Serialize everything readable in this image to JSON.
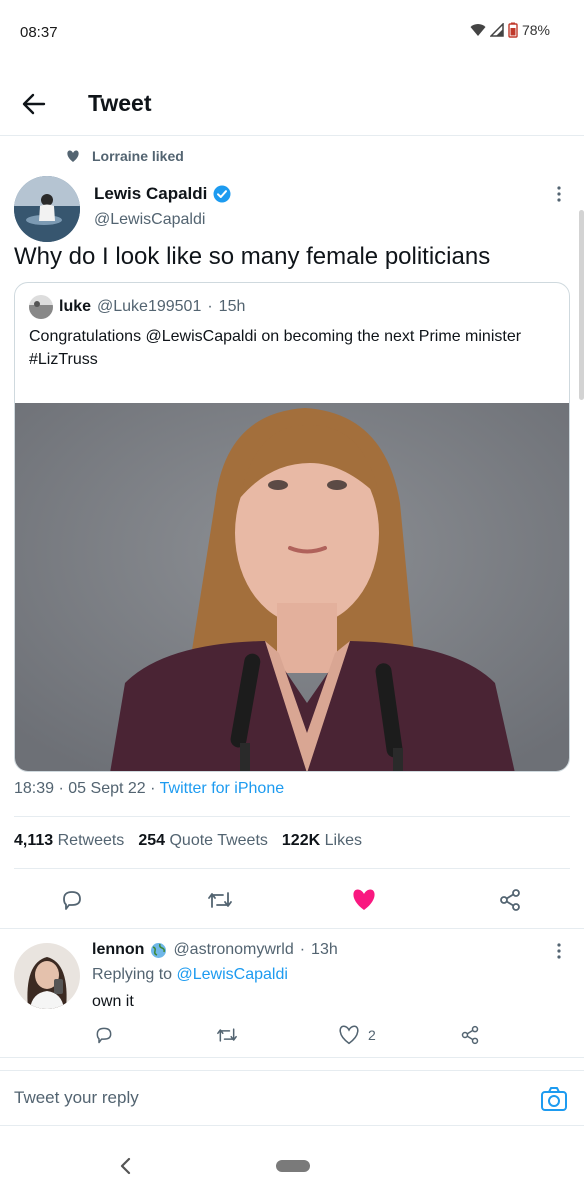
{
  "status_bar": {
    "time": "08:37",
    "battery": "78%"
  },
  "header": {
    "title": "Tweet"
  },
  "social_context": {
    "text": "Lorraine liked"
  },
  "tweet": {
    "author_name": "Lewis Capaldi",
    "author_handle": "@LewisCapaldi",
    "text": "Why do I look like so many female politicians",
    "time": "18:39",
    "date": "05 Sept 22",
    "source": "Twitter for iPhone",
    "separator": "·"
  },
  "quoted_tweet": {
    "author_name": "luke",
    "author_handle": "@Luke199501",
    "age": "15h",
    "separator": "·",
    "text_line1": "Congratulations @LewisCapaldi on becoming the next Prime minister",
    "text_line2": "#LizTruss"
  },
  "stats": {
    "retweets_count": "4,113",
    "retweets_label": "Retweets",
    "quotes_count": "254",
    "quotes_label": "Quote Tweets",
    "likes_count": "122K",
    "likes_label": "Likes"
  },
  "reply": {
    "author_name": "lennon",
    "author_handle": "@astronomywrld",
    "age": "13h",
    "separator": "·",
    "replying_prefix": "Replying to",
    "replying_to": "@LewisCapaldi",
    "text": "own it",
    "like_count": "2"
  },
  "composer": {
    "placeholder": "Tweet your reply"
  },
  "colors": {
    "accent": "#1d9bf0",
    "like": "#f91880",
    "muted": "#536471"
  },
  "icons": [
    "back-arrow-icon",
    "heart-icon",
    "verified-badge-icon",
    "more-icon",
    "reply-icon",
    "retweet-icon",
    "share-icon",
    "globe-icon",
    "camera-icon"
  ]
}
